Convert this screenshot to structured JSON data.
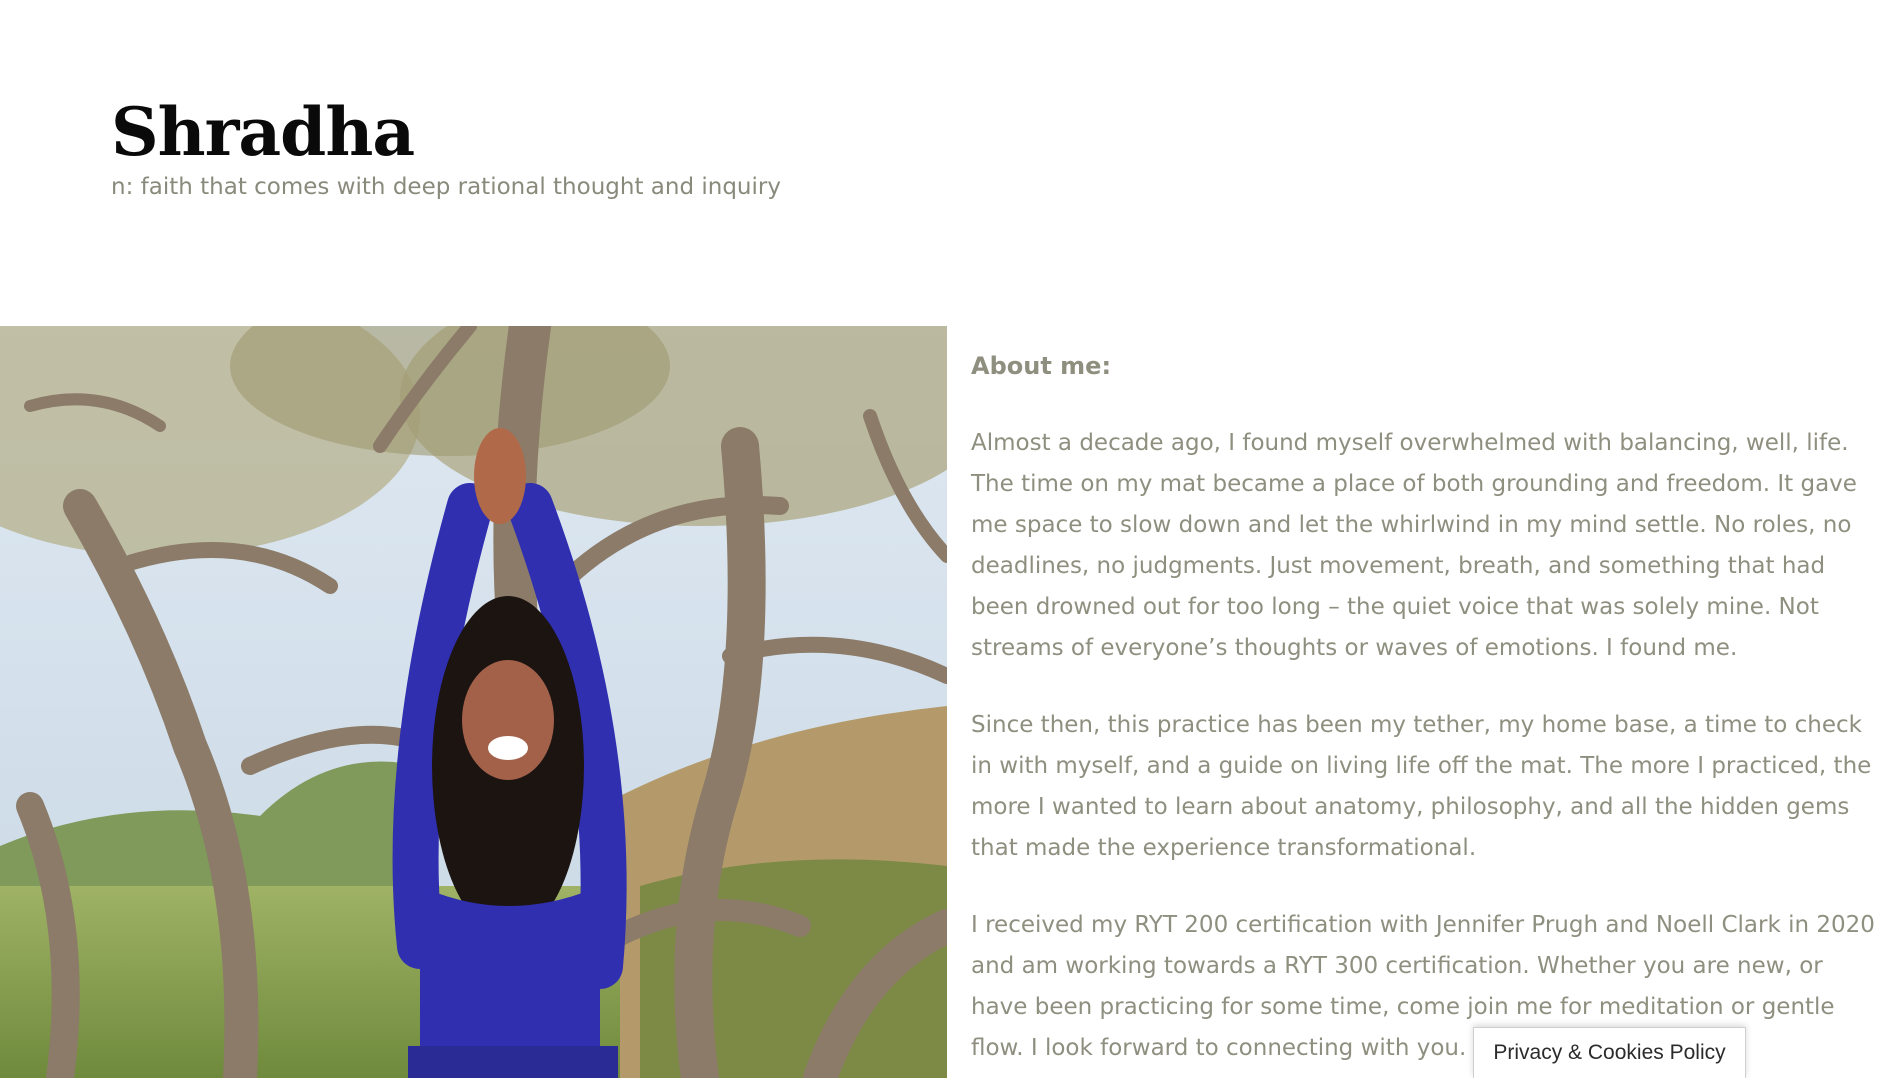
{
  "site": {
    "title": "Shradha",
    "tagline": "n: faith that comes with deep rational thought and inquiry"
  },
  "about": {
    "heading": "About me:",
    "paragraphs": [
      "Almost a decade ago, I found myself overwhelmed with balancing, well, life. The time on my mat became a place of both grounding and freedom. It gave me space to slow down and let the whirlwind in my mind settle. No roles, no deadlines, no judgments. Just movement, breath, and something that had been drowned out for too long – the quiet voice that was solely mine. Not streams of everyone’s thoughts or waves of emotions. I found me.",
      "Since then, this practice has been my tether, my home base, a time to check in with myself, and a guide on living life off the mat. The more I practiced, the more I wanted to learn about anatomy, philosophy, and all the hidden gems that made the experience transformational.",
      "I received my RYT 200 certification with Jennifer Prugh and Noell Clark in 2020 and am working towards a RYT 300 certification. Whether you are new, or have been practicing for some time, come join me for meditation or  gentle flow. I look forward to connecting with you."
    ]
  },
  "cookie_banner": {
    "label": "Privacy & Cookies Policy"
  },
  "colors": {
    "body_text": "#8f8f80",
    "title": "#0a0a0a",
    "shirt": "#2f2fb0"
  }
}
